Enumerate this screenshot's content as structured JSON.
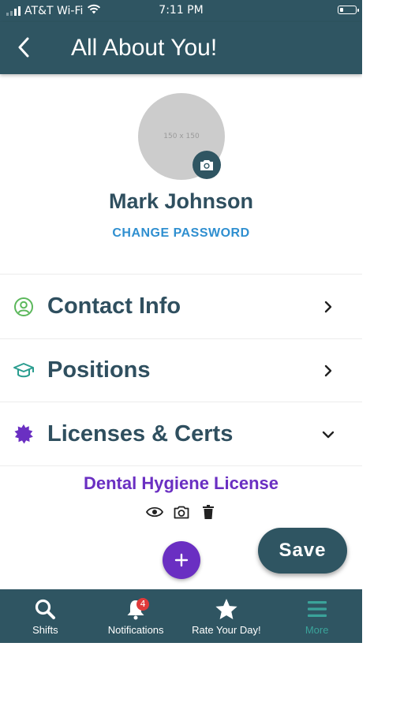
{
  "status_bar": {
    "carrier": "AT&T Wi-Fi",
    "time": "7:11 PM"
  },
  "header": {
    "title": "All About You!"
  },
  "profile": {
    "avatar_placeholder": "150 x 150",
    "name": "Mark Johnson",
    "change_password_label": "CHANGE PASSWORD"
  },
  "sections": [
    {
      "title": "Contact Info",
      "icon": "user-circle-icon",
      "expanded": false
    },
    {
      "title": "Positions",
      "icon": "graduation-cap-icon",
      "expanded": false
    },
    {
      "title": "Licenses & Certs",
      "icon": "badge-certificate-icon",
      "expanded": true
    }
  ],
  "licenses": [
    {
      "name": "Dental Hygiene License",
      "actions": [
        "eye-icon",
        "camera-icon",
        "trash-icon"
      ]
    }
  ],
  "save_label": "Save",
  "tabbar": {
    "items": [
      {
        "label": "Shifts",
        "icon": "search-icon"
      },
      {
        "label": "Notifications",
        "icon": "bell-icon",
        "badge": "4"
      },
      {
        "label": "Rate Your Day!",
        "icon": "star-icon"
      },
      {
        "label": "More",
        "icon": "menu-icon",
        "active": true
      }
    ]
  },
  "colors": {
    "primary": "#2f5562",
    "accent_purple": "#6a2fc2",
    "link_blue": "#2f8fd0",
    "contact_icon": "#5cb85c",
    "positions_icon": "#2a9d8f",
    "active_tab": "#3aa39a",
    "badge_red": "#e03a3a"
  }
}
